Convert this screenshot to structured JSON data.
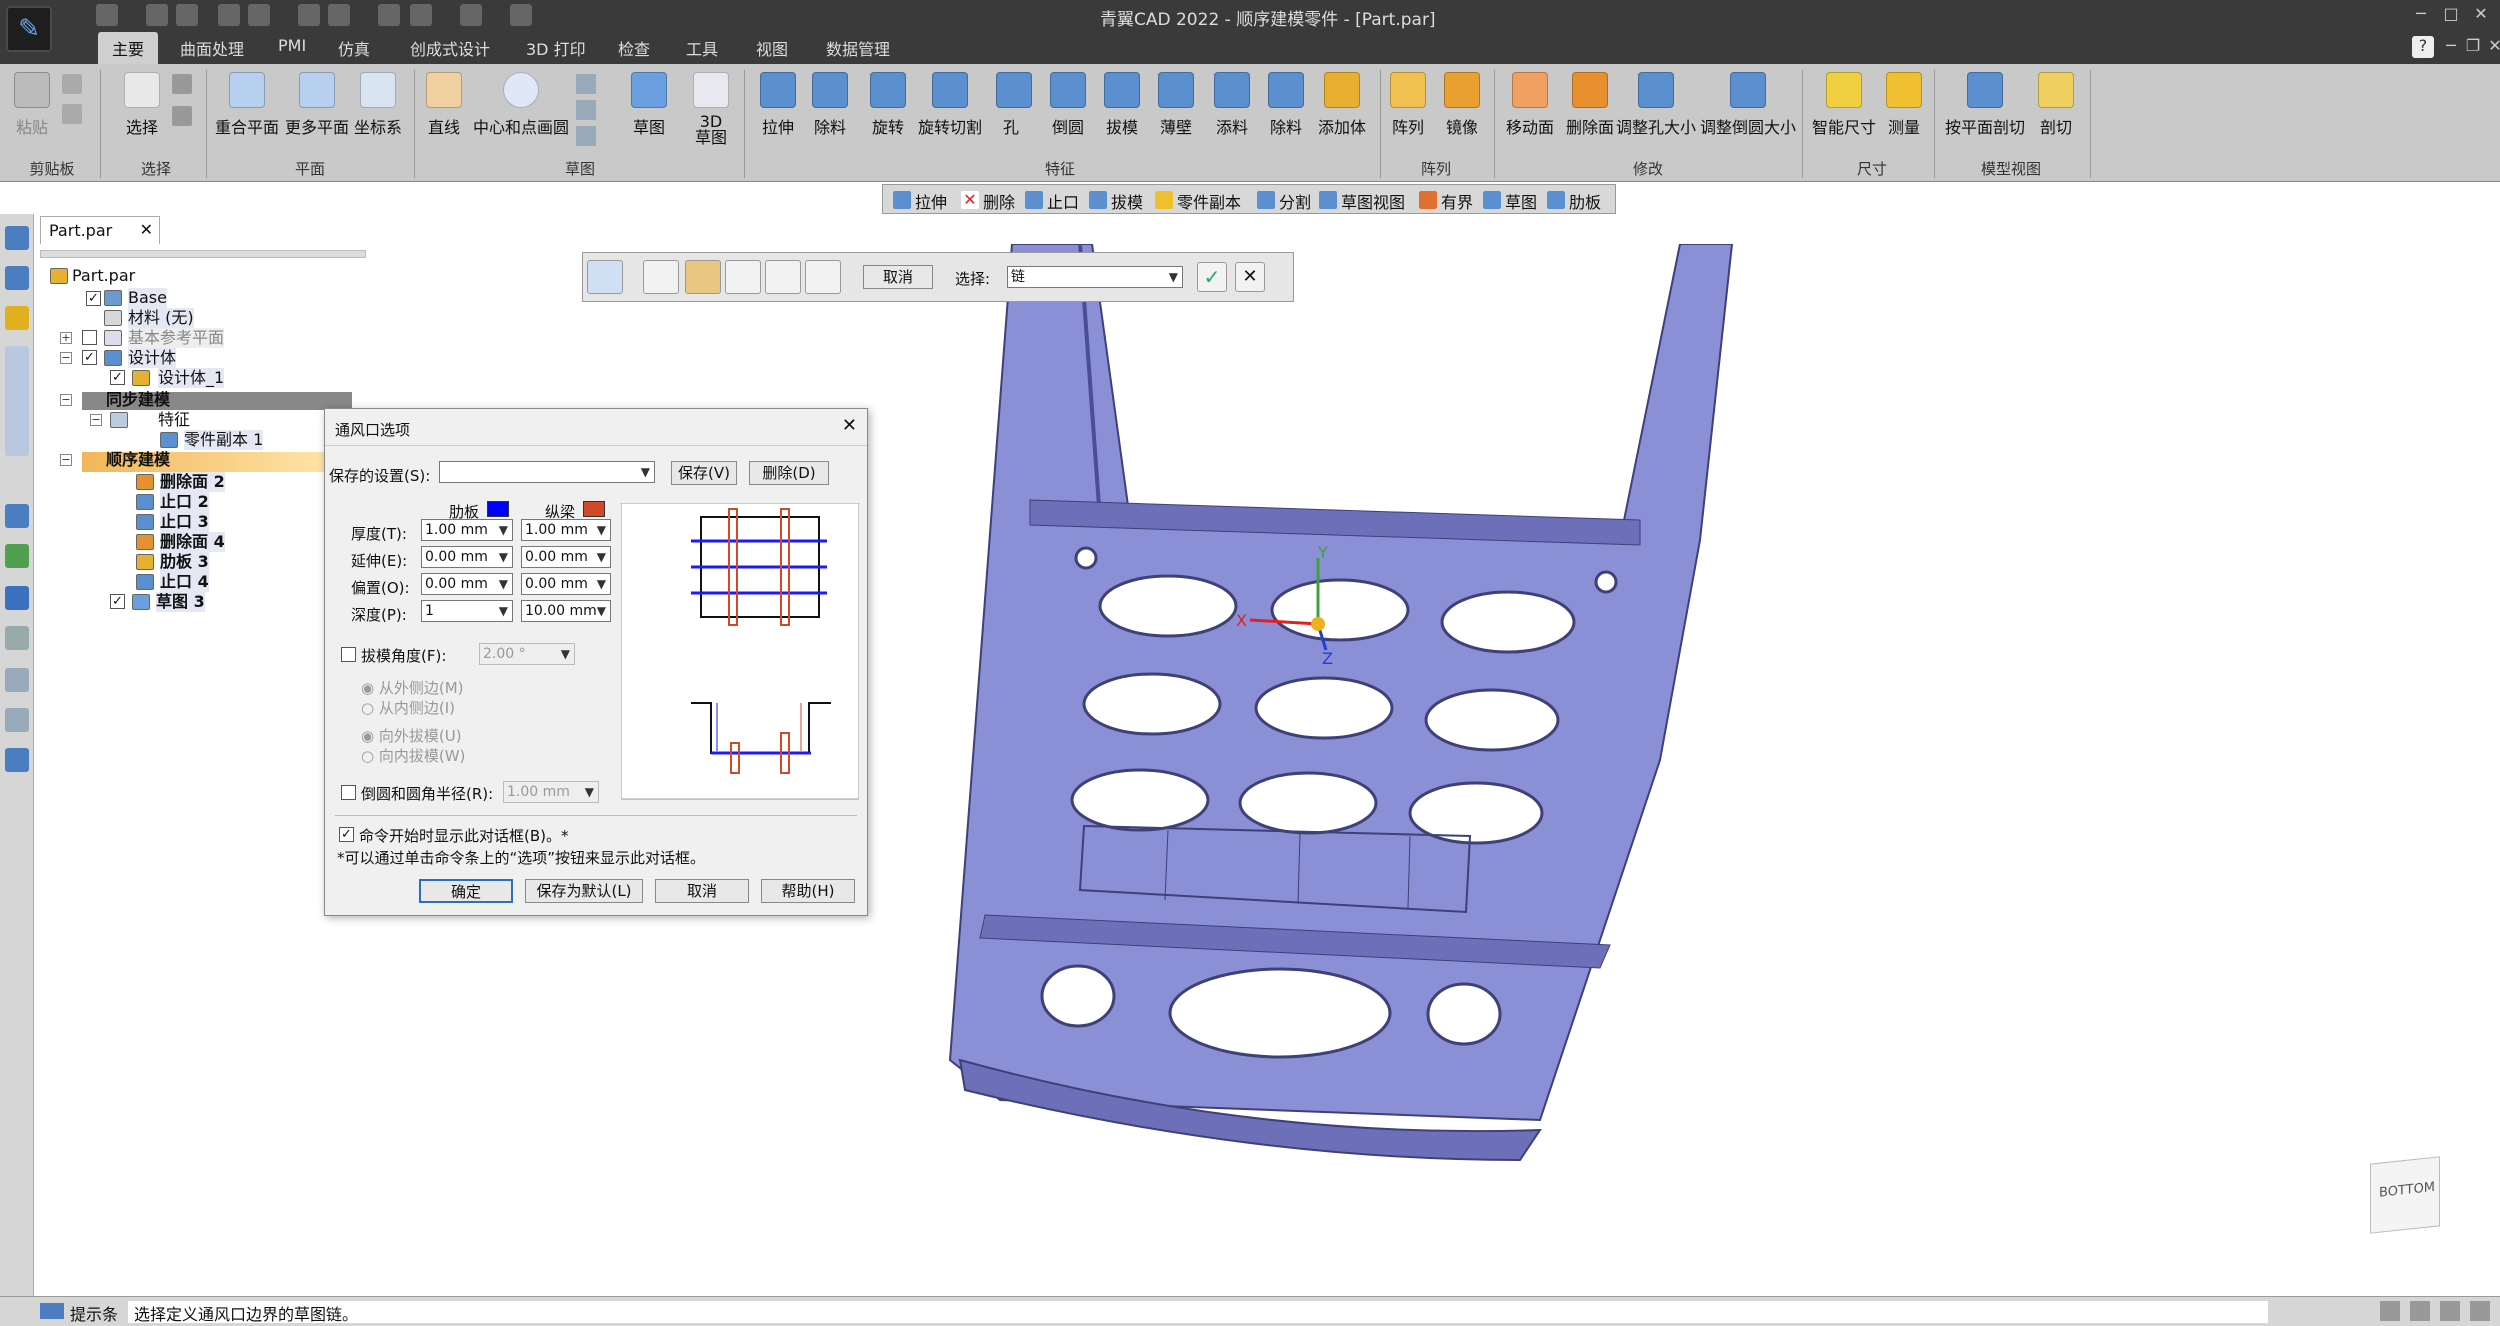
{
  "window": {
    "title": "青翼CAD 2022 - 顺序建模零件 - [Part.par]"
  },
  "tabs": [
    {
      "label": "主要",
      "active": true
    },
    {
      "label": "曲面处理"
    },
    {
      "label": "PMI"
    },
    {
      "label": "仿真"
    },
    {
      "label": "创成式设计"
    },
    {
      "label": "3D 打印"
    },
    {
      "label": "检查"
    },
    {
      "label": "工具"
    },
    {
      "label": "视图"
    },
    {
      "label": "数据管理"
    }
  ],
  "ribbon": {
    "paste": "粘贴",
    "select": "选择",
    "coincident_plane": "重合平面",
    "more_planes": "更多平面",
    "coord_system": "坐标系",
    "line": "直线",
    "center_circle": "中心和点画圆",
    "sketch": "草图",
    "sketch3d": "3D\n草图",
    "extrude": "拉伸",
    "cutout": "除料",
    "revolve": "旋转",
    "revolve_cut": "旋转切割",
    "hole": "孔",
    "round": "倒圆",
    "draft": "拔模",
    "thin_wall": "薄壁",
    "add_material": "添料",
    "remove_material": "除料",
    "add_body": "添加体",
    "pattern": "阵列",
    "mirror": "镜像",
    "move_face": "移动面",
    "delete_face": "删除面",
    "resize_hole": "调整孔大小",
    "resize_round": "调整倒圆大小",
    "smart_dim": "智能尺寸",
    "measure": "测量",
    "plane_cut": "按平面剖切",
    "section": "剖切",
    "groups": {
      "clipboard": "剪贴板",
      "select": "选择",
      "plane": "平面",
      "sketch": "草图",
      "features": "特征",
      "pattern": "阵列",
      "modify": "修改",
      "dimension": "尺寸",
      "model_view": "模型视图"
    }
  },
  "quickbar": [
    "拉伸",
    "删除",
    "止口",
    "拔模",
    "零件副本",
    "分割",
    "草图视图",
    "有界",
    "草图",
    "肋板"
  ],
  "doc_tab": "Part.par",
  "tree": {
    "root": "Part.par",
    "base": "Base",
    "material": "材料 (无)",
    "ref_planes": "基本参考平面",
    "design_body": "设计体",
    "design_body_1": "设计体_1",
    "sync": "同步建模",
    "features": "特征",
    "part_copy": "零件副本 1",
    "ordered": "顺序建模",
    "items": [
      "删除面 2",
      "止口 2",
      "止口 3",
      "删除面 4",
      "肋板 3",
      "止口 4",
      "草图 3"
    ]
  },
  "cmdbar": {
    "cancel": "取消",
    "select_label": "选择:",
    "select_value": "链"
  },
  "dialog": {
    "title": "通风口选项",
    "saved_settings": "保存的设置(S):",
    "save": "保存(V)",
    "delete": "删除(D)",
    "rib_header": "肋板",
    "spar_header": "纵梁",
    "thickness": "厚度(T):",
    "extend": "延伸(E):",
    "offset": "偏置(O):",
    "depth": "深度(P):",
    "rib_thickness": "1.00 mm",
    "rib_extend": "0.00 mm",
    "rib_offset": "0.00 mm",
    "rib_depth": "1",
    "spar_thickness": "1.00 mm",
    "spar_extend": "0.00 mm",
    "spar_offset": "0.00 mm",
    "spar_depth": "10.00 mm",
    "draft_angle": "拔模角度(F):",
    "draft_value": "2.00 °",
    "from_outside": "从外侧边(M)",
    "from_inside": "从内侧边(I)",
    "draft_out": "向外拔模(U)",
    "draft_in": "向内拔模(W)",
    "round_radius": "倒圆和圆角半径(R):",
    "round_value": "1.00 mm",
    "show_dialog": "命令开始时显示此对话框(B)。*",
    "note": "*可以通过单击命令条上的“选项”按钮来显示此对话框。",
    "ok": "确定",
    "save_default": "保存为默认(L)",
    "cancel": "取消",
    "help": "帮助(H)",
    "rib_color": "#0000ff",
    "spar_color": "#d04a2a"
  },
  "view_cube": "BOTTOM",
  "status": {
    "label": "提示条",
    "text": "选择定义通风口边界的草图链。"
  },
  "colors": {
    "model": "#8b8fd6",
    "accent": "#2c6fbf"
  }
}
